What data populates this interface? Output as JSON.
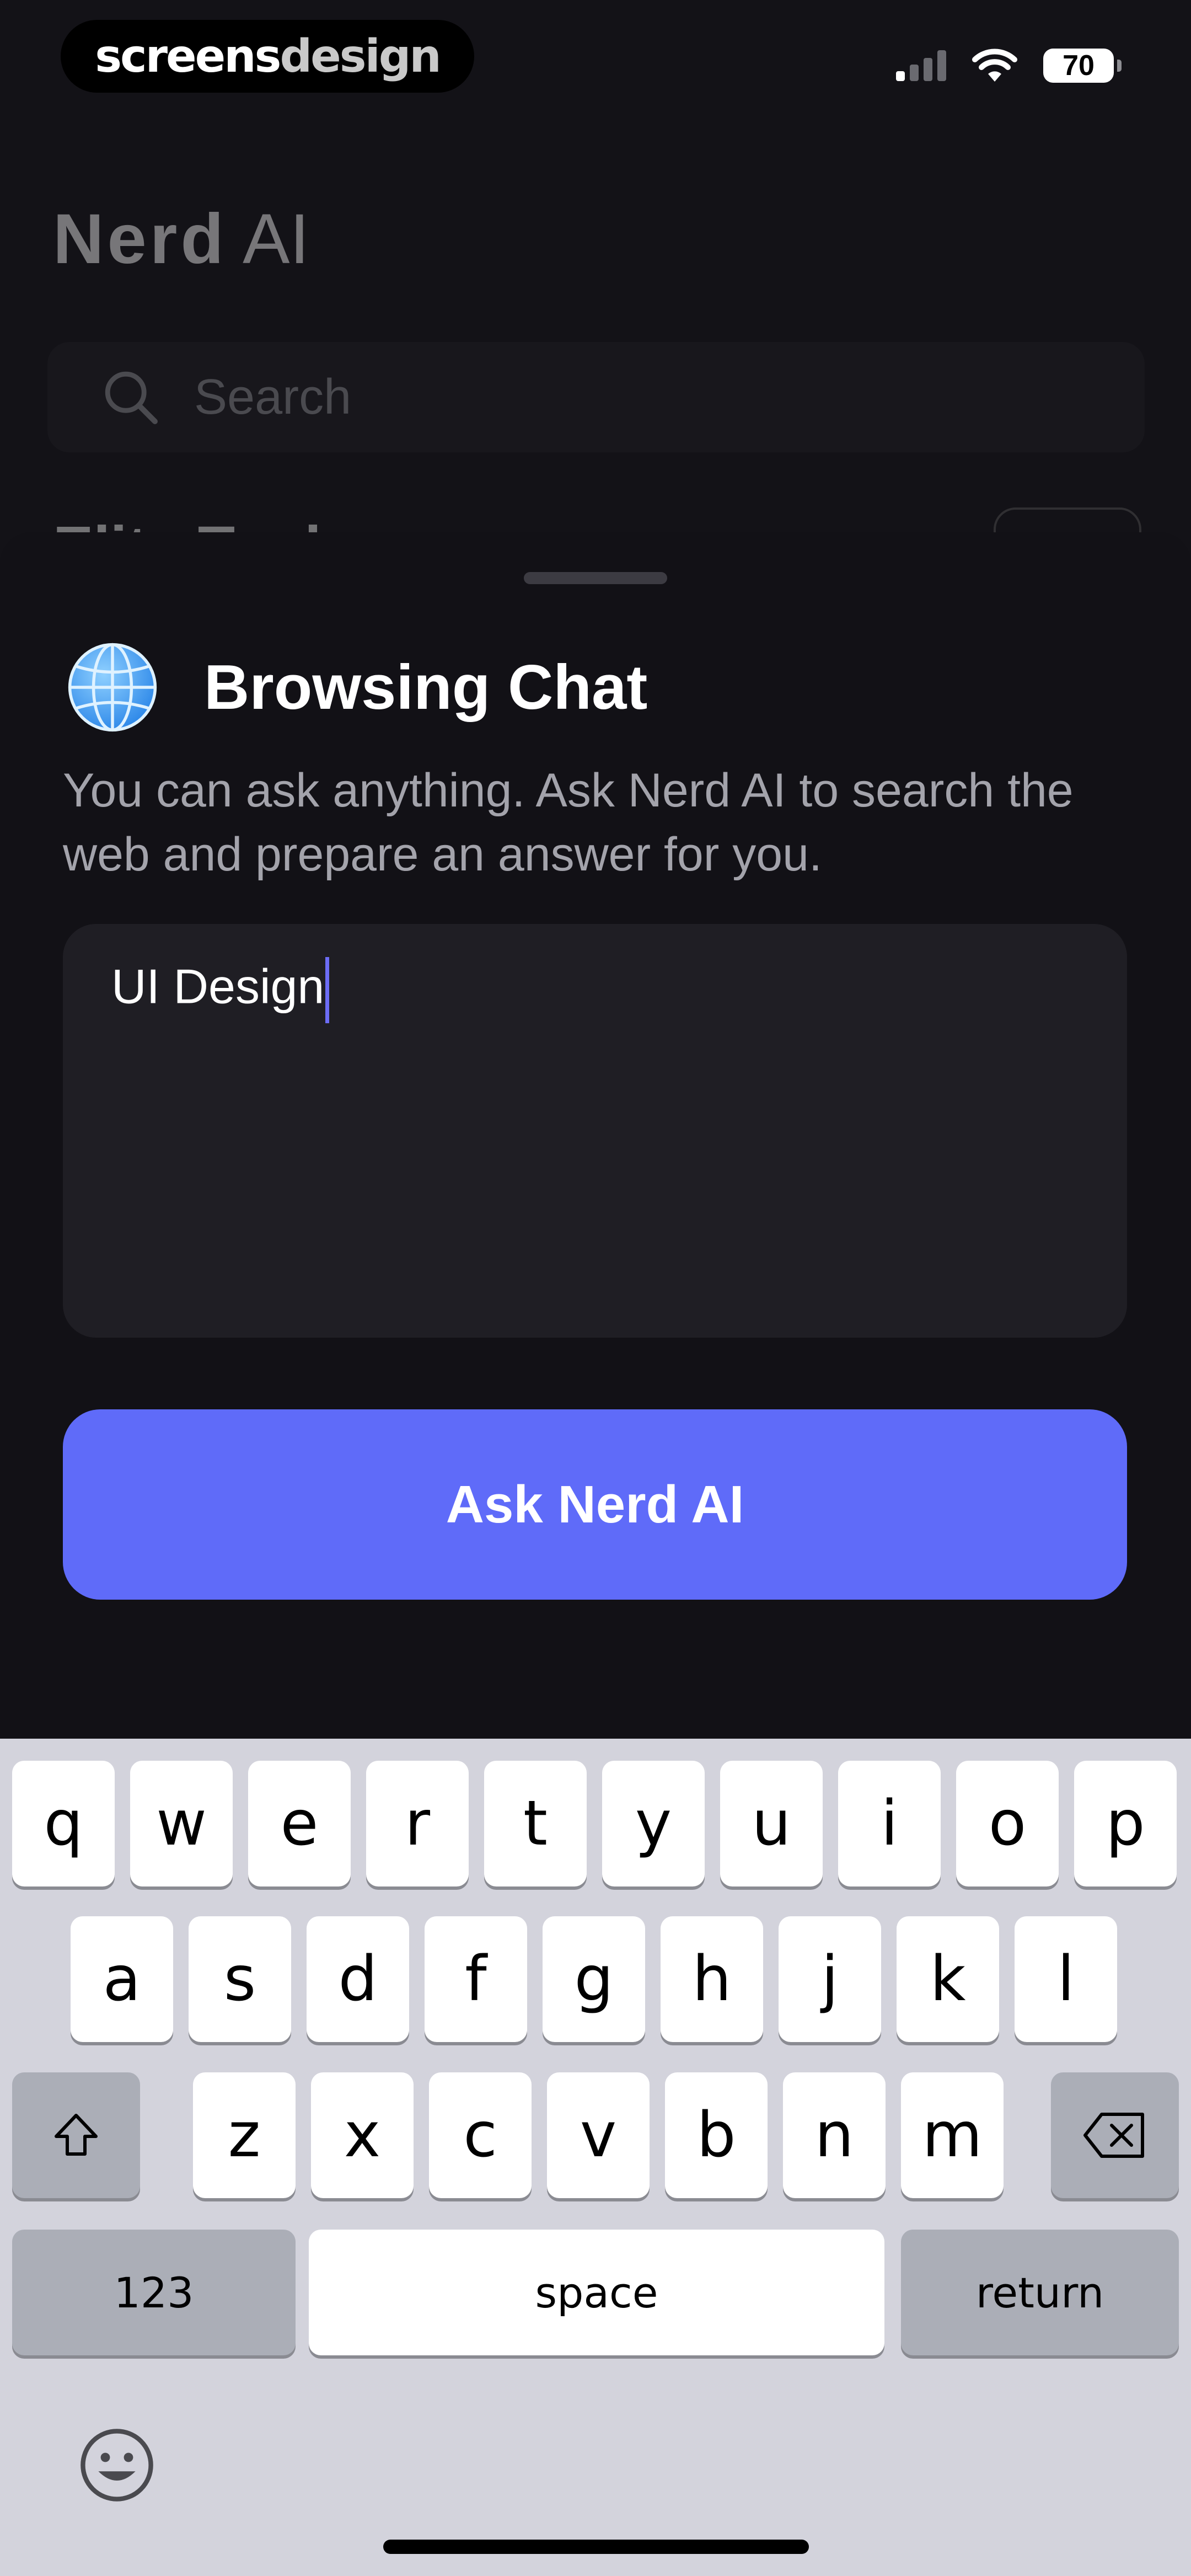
{
  "status_bar": {
    "brand_part1": "screens",
    "brand_part2": "design",
    "battery": "70"
  },
  "background": {
    "app_title_bold": "Nerd",
    "app_title_light": "AI",
    "search_placeholder": "Search",
    "section_partial": "Elite Tools"
  },
  "sheet": {
    "title": "Browsing Chat",
    "description": "You can ask anything. Ask Nerd AI to search the web and prepare an answer for you.",
    "input_value": "UI Design",
    "button_label": "Ask Nerd AI",
    "accent_color": "#5f6bf9"
  },
  "keyboard": {
    "row1": [
      "q",
      "w",
      "e",
      "r",
      "t",
      "y",
      "u",
      "i",
      "o",
      "p"
    ],
    "row2": [
      "a",
      "s",
      "d",
      "f",
      "g",
      "h",
      "j",
      "k",
      "l"
    ],
    "row3": [
      "z",
      "x",
      "c",
      "v",
      "b",
      "n",
      "m"
    ],
    "numbers_key": "123",
    "space_key": "space",
    "return_key": "return"
  }
}
